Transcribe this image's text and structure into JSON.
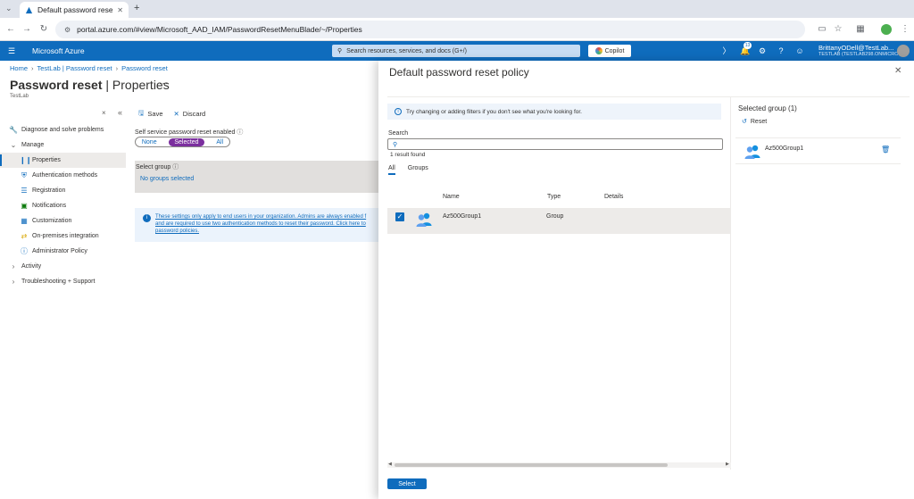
{
  "browser": {
    "tab_title": "Default password reset p",
    "new_tab": "+",
    "url": "portal.azure.com/#view/Microsoft_AAD_IAM/PasswordResetMenuBlade/~/Properties"
  },
  "azure": {
    "brand": "Microsoft Azure",
    "search_placeholder": "Search resources, services, and docs (G+/)",
    "copilot": "Copilot",
    "notification_count": "13",
    "user_name": "BrittanyODell@TestLab...",
    "user_tenant": "TESTLAB (TESTLAB298.ONMICRO..."
  },
  "blade": {
    "breadcrumb": [
      "Home",
      "TestLab | Password reset",
      "Password reset"
    ],
    "title_bold": "Password reset",
    "title_rest": " | Properties",
    "subtitle": "TestLab",
    "ellipsis": "···",
    "sidebar": [
      {
        "label": "Diagnose and solve problems",
        "icon": "wrench-icon",
        "indent": false
      },
      {
        "label": "Manage",
        "icon": "chevron-down-icon",
        "indent": false
      },
      {
        "label": "Properties",
        "icon": "properties-icon",
        "indent": true
      },
      {
        "label": "Authentication methods",
        "icon": "shield-icon",
        "indent": true
      },
      {
        "label": "Registration",
        "icon": "list-icon",
        "indent": true
      },
      {
        "label": "Notifications",
        "icon": "notification-icon",
        "indent": true
      },
      {
        "label": "Customization",
        "icon": "customization-icon",
        "indent": true
      },
      {
        "label": "On-premises integration",
        "icon": "sync-icon",
        "indent": true
      },
      {
        "label": "Administrator Policy",
        "icon": "info-icon",
        "indent": true
      },
      {
        "label": "Activity",
        "icon": "chevron-right-icon",
        "indent": false
      },
      {
        "label": "Troubleshooting + Support",
        "icon": "chevron-right-icon",
        "indent": false
      }
    ],
    "toolbar": {
      "save": "Save",
      "discard": "Discard"
    },
    "sspr_label": "Self service password reset enabled",
    "toggle": {
      "none": "None",
      "selected": "Selected",
      "all": "All"
    },
    "select_group_label": "Select group",
    "select_group_value": "No groups selected",
    "info_lines": [
      "These settings only apply to end users in your organization. Admins are always enabled f",
      "and are required to use two authentication methods to reset their password. Click here to",
      "password policies."
    ]
  },
  "panel": {
    "title": "Default password reset policy",
    "hint": "Try changing or adding filters if you don't see what you're looking for.",
    "search_label": "Search",
    "result_count": "1 result found",
    "tabs": [
      "All",
      "Groups"
    ],
    "columns": {
      "name": "Name",
      "type": "Type",
      "details": "Details"
    },
    "rows": [
      {
        "name": "Az500Group1",
        "type": "Group",
        "details": "",
        "checked": true
      }
    ],
    "select_button": "Select",
    "selected_title": "Selected group (1)",
    "reset": "Reset",
    "selected_items": [
      "Az500Group1"
    ]
  },
  "colors": {
    "azure_blue": "#0f6cbd",
    "toggle_selected": "#7b2f9e"
  }
}
